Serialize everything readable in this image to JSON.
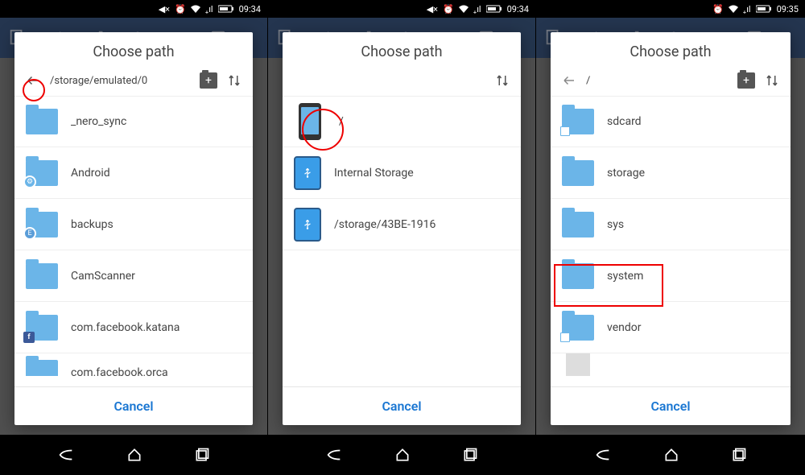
{
  "status": {
    "time1": "09:34",
    "time2": "09:34",
    "time3": "09:35"
  },
  "dialog_title": "Choose path",
  "cancel_label": "Cancel",
  "screen1": {
    "path": "/storage/emulated/0",
    "items": [
      {
        "label": "_nero_sync",
        "type": "folder"
      },
      {
        "label": "Android",
        "type": "folder-gear"
      },
      {
        "label": "backups",
        "type": "folder-es"
      },
      {
        "label": "CamScanner",
        "type": "folder"
      },
      {
        "label": "com.facebook.katana",
        "type": "folder-fb"
      },
      {
        "label": "com.facebook.orca",
        "type": "folder"
      }
    ]
  },
  "screen2": {
    "items": [
      {
        "label": "/",
        "type": "phone"
      },
      {
        "label": "Internal Storage",
        "type": "usb"
      },
      {
        "label": "/storage/43BE-1916",
        "type": "usb"
      }
    ]
  },
  "screen3": {
    "path": "/",
    "items": [
      {
        "label": "sdcard",
        "type": "folder-link"
      },
      {
        "label": "storage",
        "type": "folder"
      },
      {
        "label": "sys",
        "type": "folder"
      },
      {
        "label": "system",
        "type": "folder"
      },
      {
        "label": "vendor",
        "type": "folder-link"
      },
      {
        "label": "",
        "type": "file"
      }
    ]
  }
}
